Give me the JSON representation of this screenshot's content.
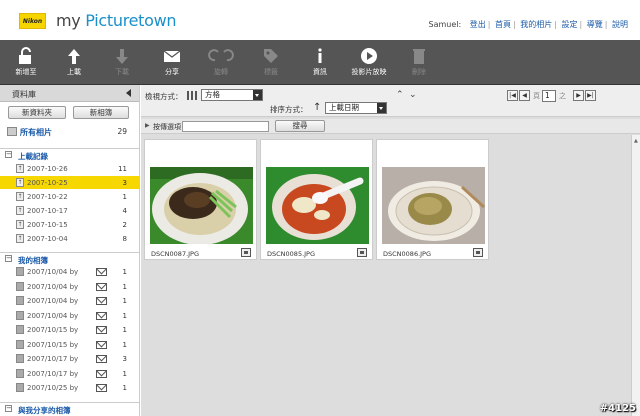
{
  "header": {
    "logo_text": "Nikon",
    "brand_prefix": "my ",
    "brand_name": "Picturetown",
    "user": "Samuel:",
    "links": [
      "登出",
      "首頁",
      "我的相片",
      "設定",
      "導覽",
      "說明"
    ]
  },
  "toolbar": {
    "items": [
      {
        "label": "新增至",
        "icon": "unlock-icon",
        "enabled": true
      },
      {
        "label": "上載",
        "icon": "upload-arrow-icon",
        "enabled": true
      },
      {
        "label": "下載",
        "icon": "download-arrow-icon",
        "enabled": false
      },
      {
        "label": "分享",
        "icon": "envelope-icon",
        "enabled": true
      },
      {
        "label": "旋轉",
        "icon": "rotate-icon",
        "enabled": false
      },
      {
        "label": "標籤",
        "icon": "tag-icon",
        "enabled": false
      },
      {
        "label": "資訊",
        "icon": "info-icon",
        "enabled": true
      },
      {
        "label": "投影片放映",
        "icon": "play-icon",
        "enabled": true
      },
      {
        "label": "刪除",
        "icon": "trash-icon",
        "enabled": false
      }
    ]
  },
  "sidebar": {
    "title": "資料庫",
    "new_folder": "新資料夾",
    "new_album": "新相簿",
    "all_photos": {
      "label": "所有相片",
      "count": "29"
    },
    "upload_section": "上載記錄",
    "upload_rows": [
      {
        "date": "2007-10-26",
        "count": "11",
        "selected": false
      },
      {
        "date": "2007-10-25",
        "count": "3",
        "selected": true
      },
      {
        "date": "2007-10-22",
        "count": "1",
        "selected": false
      },
      {
        "date": "2007-10-17",
        "count": "4",
        "selected": false
      },
      {
        "date": "2007-10-15",
        "count": "2",
        "selected": false
      },
      {
        "date": "2007-10-04",
        "count": "8",
        "selected": false
      }
    ],
    "album_section": "我的相簿",
    "album_rows": [
      {
        "label": "2007/10/04 by",
        "count": "1"
      },
      {
        "label": "2007/10/04 by",
        "count": "1"
      },
      {
        "label": "2007/10/04 by",
        "count": "1"
      },
      {
        "label": "2007/10/04 by",
        "count": "1"
      },
      {
        "label": "2007/10/15 by",
        "count": "1"
      },
      {
        "label": "2007/10/15 by",
        "count": "1"
      },
      {
        "label": "2007/10/17 by",
        "count": "3"
      },
      {
        "label": "2007/10/17 by",
        "count": "1"
      },
      {
        "label": "2007/10/25 by",
        "count": "1"
      }
    ],
    "shared_section": "與我分享的相簿"
  },
  "controls": {
    "view_label": "檢視方式：",
    "view_value": "方格",
    "sort_label": "排序方式：",
    "sort_value": "上載日期",
    "page_label": "頁",
    "page_value": "1",
    "page_of": "之",
    "search_label": "按傳選項",
    "search_placeholder": "",
    "search_button": "搜尋"
  },
  "photos": [
    {
      "name": "DSCN0087.JPG"
    },
    {
      "name": "DSCN0085.JPG"
    },
    {
      "name": "DSCN0086.JPG"
    }
  ],
  "watermark": "#4125"
}
